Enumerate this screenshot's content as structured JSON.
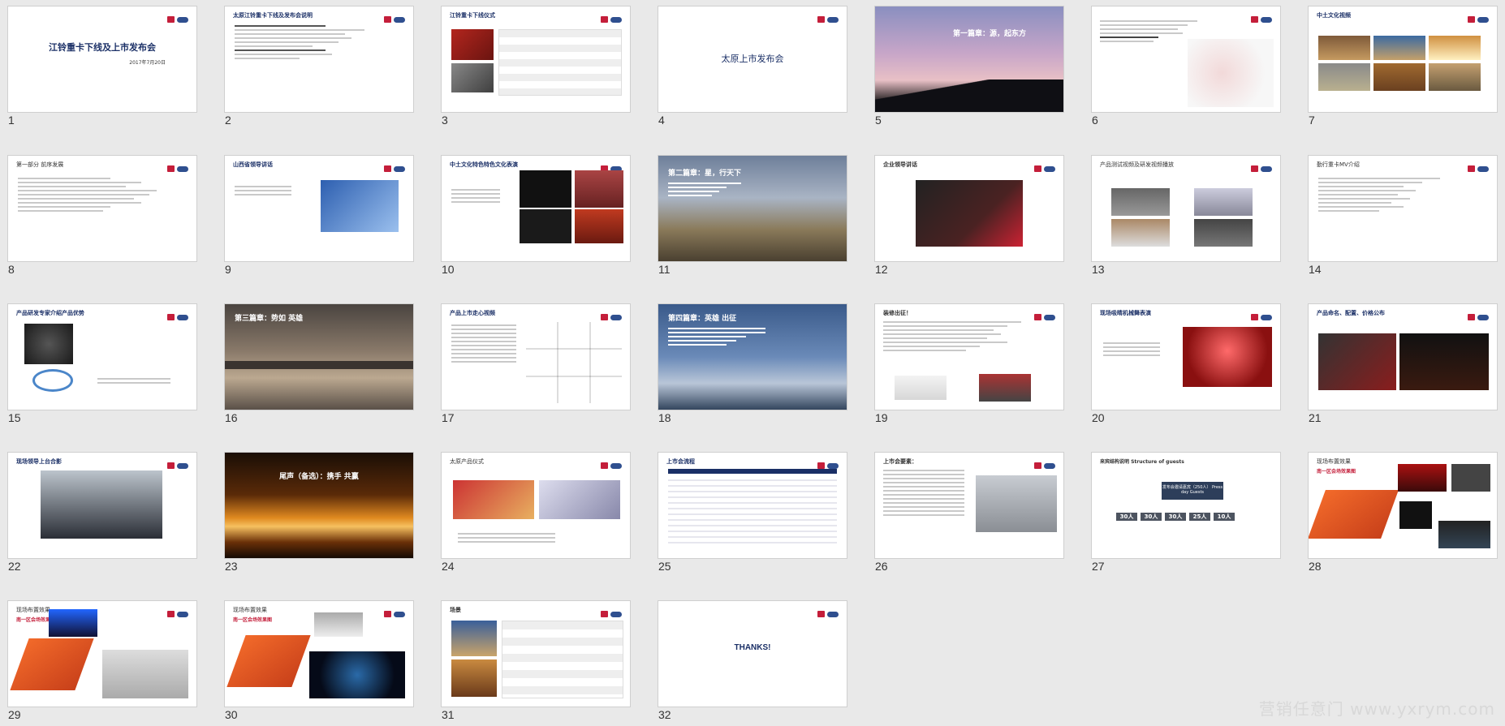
{
  "watermark": "营销任意门 www.yxrym.com",
  "slides": [
    {
      "num": "1",
      "title": "江铃重卡下线及上市发布会",
      "subtitle": "2017年7月20日"
    },
    {
      "num": "2",
      "title": "太原江铃重卡下线及发布会说明"
    },
    {
      "num": "3",
      "title": "江铃重卡下线仪式"
    },
    {
      "num": "4",
      "title": "太原上市发布会"
    },
    {
      "num": "5",
      "title": "第一篇章：源，起东方"
    },
    {
      "num": "6",
      "title": ""
    },
    {
      "num": "7",
      "title": "中土文化视频"
    },
    {
      "num": "8",
      "title": "第一部分 前序发展"
    },
    {
      "num": "9",
      "title": "山西省领导讲话"
    },
    {
      "num": "10",
      "title": "中土文化特色特色文化表演"
    },
    {
      "num": "11",
      "title": "第二篇章：星，行天下"
    },
    {
      "num": "12",
      "title": "企业领导讲话"
    },
    {
      "num": "13",
      "title": "产品测试视频及研发视频播放"
    },
    {
      "num": "14",
      "title": "勤行重卡MV介绍"
    },
    {
      "num": "15",
      "title": "产品研发专家介绍产品优势"
    },
    {
      "num": "16",
      "title": "第三篇章：势如 英雄"
    },
    {
      "num": "17",
      "title": "产品上市走心视频"
    },
    {
      "num": "18",
      "title": "第四篇章：英雄 出征"
    },
    {
      "num": "19",
      "title": "装修出征！"
    },
    {
      "num": "20",
      "title": "现场吸睛机械舞表演"
    },
    {
      "num": "21",
      "title": "产品命名、配置、价格公布"
    },
    {
      "num": "22",
      "title": "现场领导上台合影"
    },
    {
      "num": "23",
      "title": "尾声（备选）：携手 共赢"
    },
    {
      "num": "24",
      "title": "太原产品仪式"
    },
    {
      "num": "25",
      "title": "上市会流程"
    },
    {
      "num": "26",
      "title": "上市会要素："
    },
    {
      "num": "27",
      "title": "来宾结构说明 Structure of guests",
      "box": "发布会邀请嘉宾（250人） Press day Guests",
      "counts": [
        "30人",
        "30人",
        "30人",
        "25人",
        "10人"
      ]
    },
    {
      "num": "28",
      "title": "现场布置效果",
      "subtitle": "南一区会场效果图"
    },
    {
      "num": "29",
      "title": "现场布置效果",
      "subtitle": "南一区会场效果图"
    },
    {
      "num": "30",
      "title": "现场布置效果",
      "subtitle": "南一区会场效果图"
    },
    {
      "num": "31",
      "title": "场景"
    },
    {
      "num": "32",
      "title": "THANKS!"
    }
  ],
  "colors": {
    "brand_red": "#c41e3a",
    "brand_navy": "#1a2f66",
    "background": "#e9e9e9"
  }
}
